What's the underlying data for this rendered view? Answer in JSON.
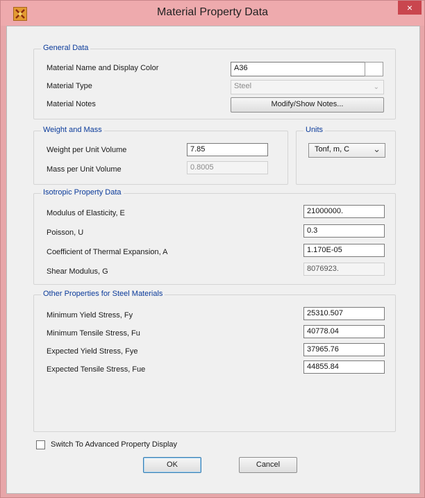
{
  "window": {
    "title": "Material Property Data",
    "close_glyph": "×",
    "icon": "app-logo-icon"
  },
  "general": {
    "title": "General Data",
    "name_label": "Material Name and Display Color",
    "name_value": "A36",
    "type_label": "Material Type",
    "type_value": "Steel",
    "notes_label": "Material Notes",
    "notes_button": "Modify/Show Notes..."
  },
  "weight": {
    "title": "Weight and Mass",
    "weight_label": "Weight per Unit Volume",
    "weight_value": "7.85",
    "mass_label": "Mass per Unit Volume",
    "mass_value": "0.8005"
  },
  "units": {
    "title": "Units",
    "value": "Tonf, m, C"
  },
  "isotropic": {
    "title": "Isotropic Property Data",
    "e_label": "Modulus of Elasticity,  E",
    "e_value": "21000000.",
    "u_label": "Poisson,  U",
    "u_value": "0.3",
    "a_label": "Coefficient of Thermal Expansion,  A",
    "a_value": "1.170E-05",
    "g_label": "Shear Modulus,  G",
    "g_value": "8076923."
  },
  "steel": {
    "title": "Other Properties for Steel Materials",
    "fy_label": "Minimum Yield Stress, Fy",
    "fy_value": "25310.507",
    "fu_label": "Minimum Tensile Stress, Fu",
    "fu_value": "40778.04",
    "fye_label": "Expected Yield Stress, Fye",
    "fye_value": "37965.76",
    "fue_label": "Expected Tensile Stress, Fue",
    "fue_value": "44855.84"
  },
  "footer": {
    "advanced_label": "Switch To Advanced Property Display",
    "ok": "OK",
    "cancel": "Cancel"
  },
  "colors": {
    "title_bar": "#eeaaad",
    "close": "#c9464e",
    "group_title": "#0a3a9a",
    "dialog_bg": "#f0f0f0"
  }
}
